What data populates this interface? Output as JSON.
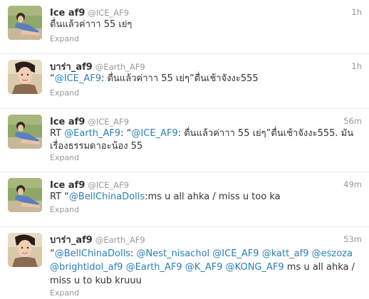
{
  "expand_label": "Expand",
  "tweets": [
    {
      "name": "Ice af9",
      "handle": "@ICE_AF9",
      "time": "1h",
      "avatar": "ice-avatar",
      "parts": [
        {
          "t": "ตื่นแล้วค่าาา 55 เย่ๆ"
        }
      ]
    },
    {
      "name": "บาร่า_af9",
      "handle": "@Earth_AF9",
      "time": "1h",
      "avatar": "earth-avatar",
      "parts": [
        {
          "t": "“"
        },
        {
          "t": "@ICE_AF9",
          "link": true
        },
        {
          "t": ": ตื่นแล้วค่าาา 55 เย่ๆ”ตื่นเช้าจังงะ555"
        }
      ]
    },
    {
      "name": "Ice af9",
      "handle": "@ICE_AF9",
      "time": "56m",
      "avatar": "ice-avatar",
      "parts": [
        {
          "t": "RT "
        },
        {
          "t": "@Earth_AF9",
          "link": true
        },
        {
          "t": ": “"
        },
        {
          "t": "@ICE_AF9",
          "link": true
        },
        {
          "t": ": ตื่นแล้วค่าาา 55 เย่ๆ”ตื่นเช้าจังงะ555. มันเรื่องธรรมดาอะน้อง 55"
        }
      ]
    },
    {
      "name": "Ice af9",
      "handle": "@ICE_AF9",
      "time": "49m",
      "avatar": "ice-avatar",
      "parts": [
        {
          "t": "RT “"
        },
        {
          "t": "@BellChinaDolls",
          "link": true
        },
        {
          "t": ":ms u all ahka / miss u too ka"
        }
      ]
    },
    {
      "name": "บาร่า_af9",
      "handle": "@Earth_AF9",
      "time": "53m",
      "avatar": "earth-avatar",
      "parts": [
        {
          "t": "“"
        },
        {
          "t": "@BellChinaDolls",
          "link": true
        },
        {
          "t": ": "
        },
        {
          "t": "@Nest_nisachol",
          "link": true
        },
        {
          "t": " "
        },
        {
          "t": "@ICE_AF9",
          "link": true
        },
        {
          "t": " "
        },
        {
          "t": "@katt_af9",
          "link": true
        },
        {
          "t": " "
        },
        {
          "t": "@eszoza",
          "link": true
        },
        {
          "t": " "
        },
        {
          "t": "@brightidol_af9",
          "link": true
        },
        {
          "t": " "
        },
        {
          "t": "@Earth_AF9",
          "link": true
        },
        {
          "t": " "
        },
        {
          "t": "@K_AF9",
          "link": true
        },
        {
          "t": " "
        },
        {
          "t": "@KONG_AF9",
          "link": true
        },
        {
          "t": " ms u all ahka / miss u to kub kruuu"
        }
      ]
    }
  ]
}
